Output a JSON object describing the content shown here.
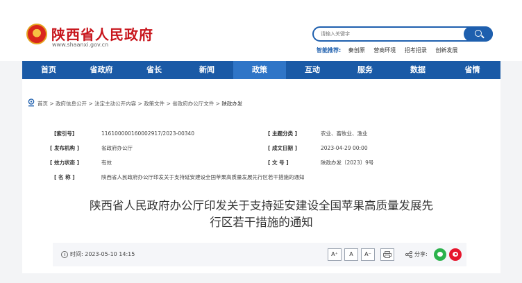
{
  "site": {
    "title": "陕西省人民政府",
    "url": "www.shaanxi.gov.cn"
  },
  "search": {
    "placeholder": "请输入关键字"
  },
  "smart_recommend": {
    "label": "智能推荐:",
    "keywords": [
      "秦创原",
      "营商环境",
      "招考招录",
      "创新发展"
    ]
  },
  "nav": {
    "items": [
      "首页",
      "省政府",
      "省长",
      "新闻",
      "政策",
      "互动",
      "服务",
      "数据",
      "省情"
    ],
    "active": "政策"
  },
  "breadcrumb": {
    "items": [
      "首页",
      "政府信息公开",
      "法定主动公开内容",
      "政策文件",
      "省政府办公厅文件"
    ],
    "current": "陕政办发"
  },
  "meta": {
    "index_label": "[索引号]",
    "index_value": "11610000016000291​7/2023-00340",
    "topic_label": "[ 主题分类 ]",
    "topic_value": "农业、畜牧业、渔业",
    "issuer_label": "[ 发布机构 ]",
    "issuer_value": "省政府办公厅",
    "date_label": "[ 成文日期 ]",
    "date_value": "2023-04-29 00:00",
    "status_label": "[ 效力状态 ]",
    "status_value": "有效",
    "docno_label": "[ 文 号 ]",
    "docno_value": "陕政办发〔2023〕9号",
    "name_label": "[ 名 称 ]",
    "name_value": "陕西省人民政府办公厅印发关于支持延安建设全国苹果高质量发展先行区若干措施的通知"
  },
  "document": {
    "title_line1": "陕西省人民政府办公厅印发关于支持延安建设全国苹果高质量发展先",
    "title_line2": "行区若干措施的通知",
    "time_label": "时间:",
    "time_value": "2023-05-10 14:15",
    "font_large": "A⁺",
    "font_medium": "A",
    "font_small": "A⁻",
    "share_label": "分享:"
  },
  "colors": {
    "brand_red": "#c8161d",
    "nav_blue": "#1a5aa6",
    "active_blue": "#2f75c7"
  }
}
